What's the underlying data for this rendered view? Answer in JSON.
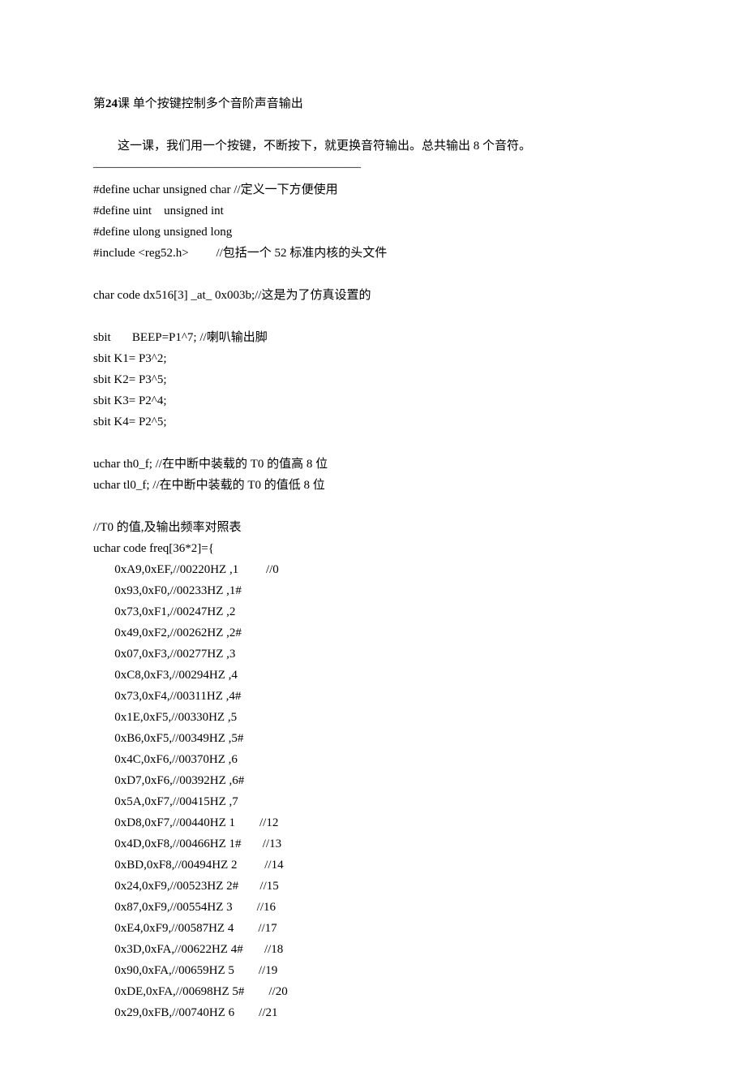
{
  "title_prefix": "第",
  "title_number": "24",
  "title_suffix": "课  单个按键控制多个音阶声音输出",
  "intro": "这一课，我们用一个按键，不断按下，就更换音符输出。总共输出 8 个音符。",
  "divider": "――――――――――――――――――――――",
  "code": [
    "#define uchar unsigned char //定义一下方便使用",
    "#define uint    unsigned int",
    "#define ulong unsigned long",
    "#include <reg52.h>         //包括一个 52 标准内核的头文件",
    "",
    "char code dx516[3] _at_ 0x003b;//这是为了仿真设置的",
    "",
    "sbit       BEEP=P1^7; //喇叭输出脚",
    "sbit K1= P3^2;",
    "sbit K2= P3^5;",
    "sbit K3= P2^4;",
    "sbit K4= P2^5;",
    "",
    "uchar th0_f; //在中断中装载的 T0 的值高 8 位",
    "uchar tl0_f; //在中断中装载的 T0 的值低 8 位",
    "",
    "//T0 的值,及输出频率对照表",
    "uchar code freq[36*2]={",
    "       0xA9,0xEF,//00220HZ ,1         //0",
    "       0x93,0xF0,//00233HZ ,1#",
    "       0x73,0xF1,//00247HZ ,2",
    "       0x49,0xF2,//00262HZ ,2#",
    "       0x07,0xF3,//00277HZ ,3",
    "       0xC8,0xF3,//00294HZ ,4",
    "       0x73,0xF4,//00311HZ ,4#",
    "       0x1E,0xF5,//00330HZ ,5",
    "       0xB6,0xF5,//00349HZ ,5#",
    "       0x4C,0xF6,//00370HZ ,6",
    "       0xD7,0xF6,//00392HZ ,6#",
    "       0x5A,0xF7,//00415HZ ,7",
    "       0xD8,0xF7,//00440HZ 1        //12",
    "       0x4D,0xF8,//00466HZ 1#       //13",
    "       0xBD,0xF8,//00494HZ 2         //14",
    "       0x24,0xF9,//00523HZ 2#       //15",
    "       0x87,0xF9,//00554HZ 3        //16",
    "       0xE4,0xF9,//00587HZ 4        //17",
    "       0x3D,0xFA,//00622HZ 4#       //18",
    "       0x90,0xFA,//00659HZ 5        //19",
    "       0xDE,0xFA,//00698HZ 5#        //20",
    "       0x29,0xFB,//00740HZ 6        //21"
  ]
}
